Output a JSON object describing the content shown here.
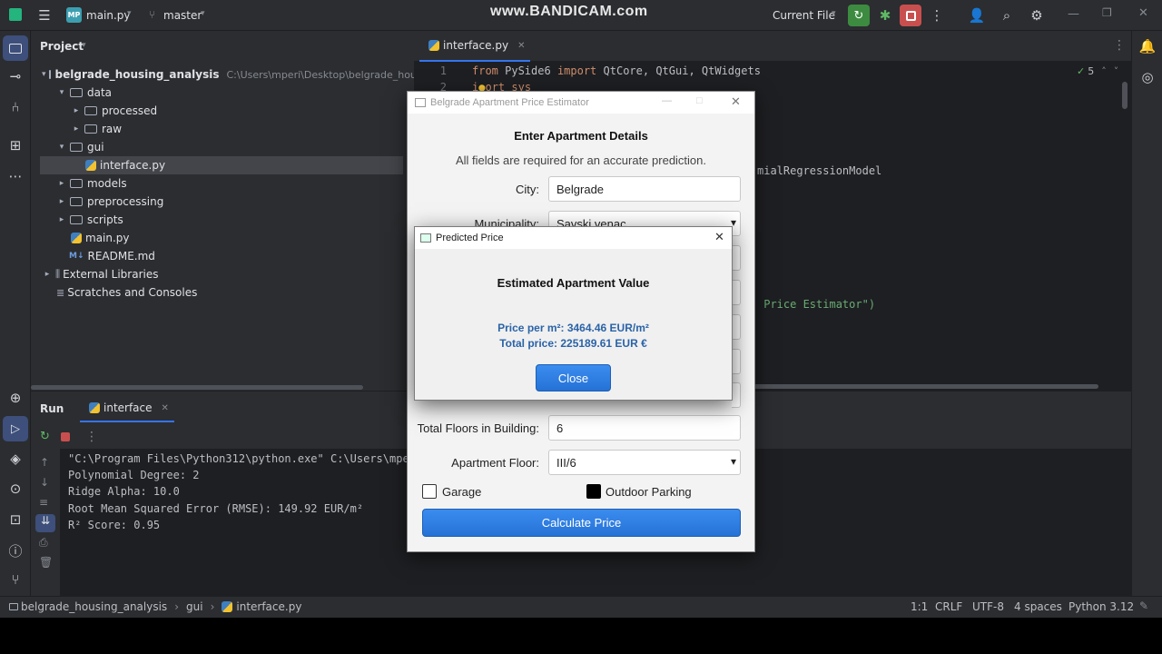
{
  "watermark": "www.BANDICAM.com",
  "titlebar": {
    "project_badge": "MP",
    "project_name": "main.py",
    "branch": "master",
    "run_config": "Current File"
  },
  "project_panel": {
    "title": "Project",
    "items": [
      {
        "label": "belgrade_housing_analysis",
        "hint": "C:\\Users\\mperi\\Desktop\\belgrade_housing"
      },
      {
        "label": "data"
      },
      {
        "label": "processed"
      },
      {
        "label": "raw"
      },
      {
        "label": "gui"
      },
      {
        "label": "interface.py"
      },
      {
        "label": "models"
      },
      {
        "label": "preprocessing"
      },
      {
        "label": "scripts"
      },
      {
        "label": "main.py"
      },
      {
        "label": "README.md"
      },
      {
        "label": "External Libraries"
      },
      {
        "label": "Scratches and Consoles"
      }
    ]
  },
  "editor": {
    "tab": "interface.py",
    "inspection_count": "5",
    "line_numbers": [
      "1",
      "2"
    ],
    "code": {
      "line1_kw1": "from",
      "line1_mod": " PySide6 ",
      "line1_kw2": "import",
      "line1_rest": " QtCore, QtGui, QtWidgets",
      "line2_a": "i",
      "line2_b": "ort sys",
      "frag_model": "mialRegressionModel",
      "frag_title": " Price Estimator\")"
    }
  },
  "run_panel": {
    "title": "Run",
    "tab": "interface",
    "console": [
      "\"C:\\Program Files\\Python312\\python.exe\" C:\\Users\\mperi\\D",
      "Polynomial Degree: 2",
      "Ridge Alpha: 10.0",
      "Root Mean Squared Error (RMSE): 149.92 EUR/m²",
      "R² Score: 0.95"
    ]
  },
  "statusbar": {
    "crumbs": [
      "belgrade_housing_analysis",
      "gui",
      "interface.py"
    ],
    "position": "1:1",
    "line_sep": "CRLF",
    "encoding": "UTF-8",
    "indent": "4 spaces",
    "interpreter": "Python 3.12"
  },
  "app_window": {
    "title": "Belgrade Apartment Price Estimator",
    "heading": "Enter Apartment Details",
    "subheading": "All fields are required for an accurate prediction.",
    "city_label": "City:",
    "city_value": "Belgrade",
    "municipality_label": "Municipality:",
    "municipality_value": "Savski venac",
    "floors_label": "Total Floors in Building:",
    "floors_value": "6",
    "apt_floor_label": "Apartment Floor:",
    "apt_floor_value": "III/6",
    "garage_label": "Garage",
    "garage_checked": false,
    "parking_label": "Outdoor Parking",
    "parking_checked": true,
    "calc_button": "Calculate Price",
    "accent": "#2f7fe0"
  },
  "modal": {
    "title": "Predicted Price",
    "heading": "Estimated Apartment Value",
    "price_per_m2": "Price per m²: 3464.46 EUR/m²",
    "total_price": "Total price: 225189.61 EUR €",
    "close_button": "Close",
    "result_color": "#2a63a8"
  }
}
